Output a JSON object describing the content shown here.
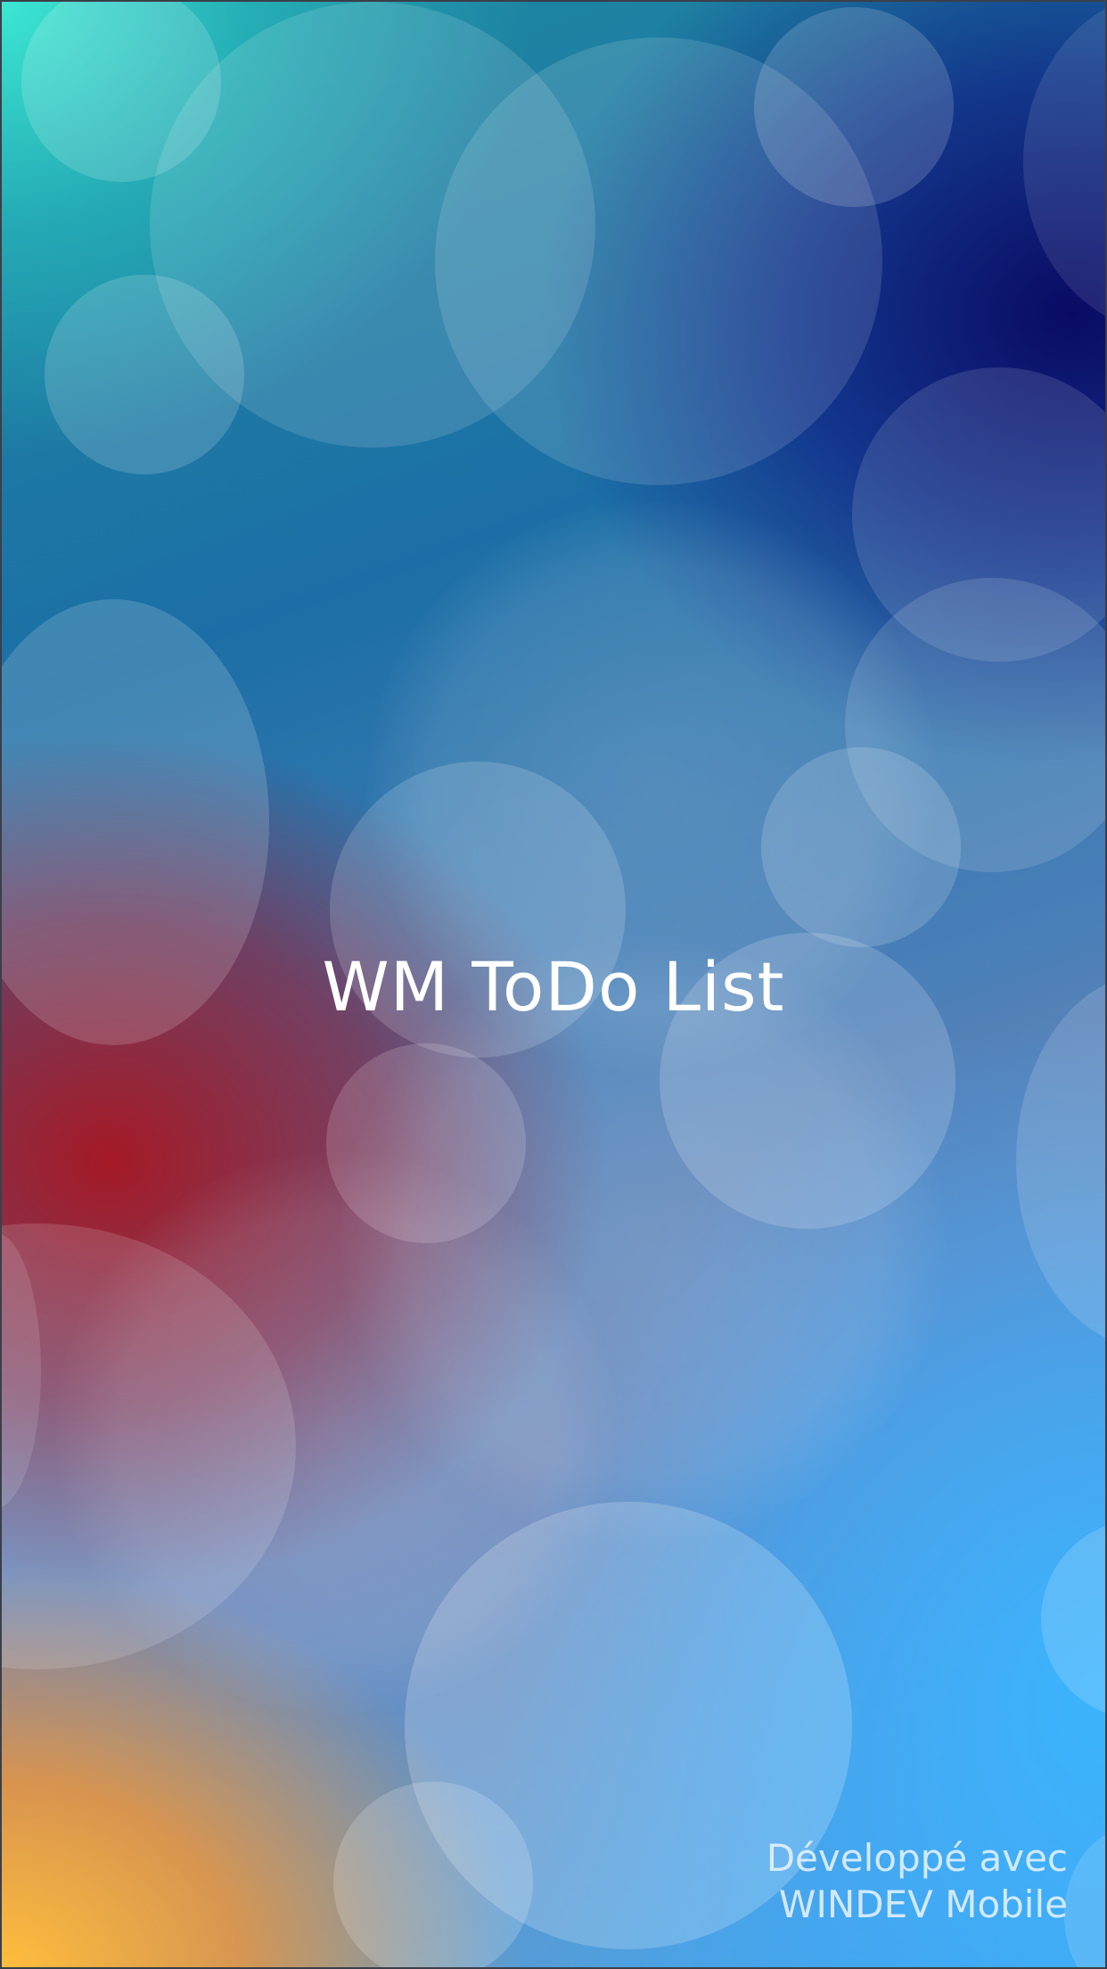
{
  "splash": {
    "title": "WM ToDo List",
    "credit_line1": "Développé avec",
    "credit_line2": "WINDEV Mobile"
  },
  "colors": {
    "title_text": "#ffffff",
    "top_left": "#3ce6d2",
    "top_right": "#0a0a64",
    "middle_left": "#aa141e",
    "bottom_left": "#ffbe3c",
    "bottom_right": "#3cb4ff"
  }
}
